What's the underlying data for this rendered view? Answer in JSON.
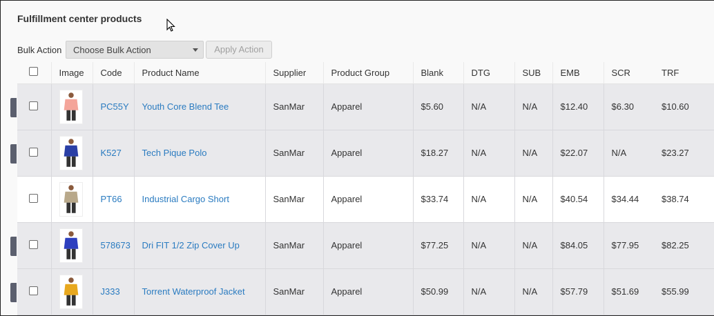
{
  "page": {
    "title": "Fulfillment center products"
  },
  "bulk": {
    "label": "Bulk Action",
    "select_value": "Choose Bulk Action",
    "apply_label": "Apply Action"
  },
  "table": {
    "headers": {
      "image": "Image",
      "code": "Code",
      "name": "Product Name",
      "supplier": "Supplier",
      "group": "Product Group",
      "blank": "Blank",
      "dtg": "DTG",
      "sub": "SUB",
      "emb": "EMB",
      "scr": "SCR",
      "trf": "TRF"
    },
    "rows": [
      {
        "code": "PC55Y",
        "name": "Youth Core Blend Tee",
        "supplier": "SanMar",
        "group": "Apparel",
        "blank": "$5.60",
        "dtg": "N/A",
        "sub": "N/A",
        "emb": "$12.40",
        "scr": "$6.30",
        "trf": "$10.60",
        "thumb_color": "#f4a59a",
        "thumb_icon": "tshirt-product-image"
      },
      {
        "code": "K527",
        "name": "Tech Pique Polo",
        "supplier": "SanMar",
        "group": "Apparel",
        "blank": "$18.27",
        "dtg": "N/A",
        "sub": "N/A",
        "emb": "$22.07",
        "scr": "N/A",
        "trf": "$23.27",
        "thumb_color": "#2a3fa6",
        "thumb_icon": "polo-product-image"
      },
      {
        "code": "PT66",
        "name": "Industrial Cargo Short",
        "supplier": "SanMar",
        "group": "Apparel",
        "blank": "$33.74",
        "dtg": "N/A",
        "sub": "N/A",
        "emb": "$40.54",
        "scr": "$34.44",
        "trf": "$38.74",
        "thumb_color": "#b8a88a",
        "thumb_icon": "shorts-product-image"
      },
      {
        "code": "578673",
        "name": "Dri FIT 1/2 Zip Cover Up",
        "supplier": "SanMar",
        "group": "Apparel",
        "blank": "$77.25",
        "dtg": "N/A",
        "sub": "N/A",
        "emb": "$84.05",
        "scr": "$77.95",
        "trf": "$82.25",
        "thumb_color": "#2d3fbf",
        "thumb_icon": "pullover-product-image"
      },
      {
        "code": "J333",
        "name": "Torrent Waterproof Jacket",
        "supplier": "SanMar",
        "group": "Apparel",
        "blank": "$50.99",
        "dtg": "N/A",
        "sub": "N/A",
        "emb": "$57.79",
        "scr": "$51.69",
        "trf": "$55.99",
        "thumb_color": "#e8a81e",
        "thumb_icon": "jacket-product-image"
      }
    ]
  }
}
